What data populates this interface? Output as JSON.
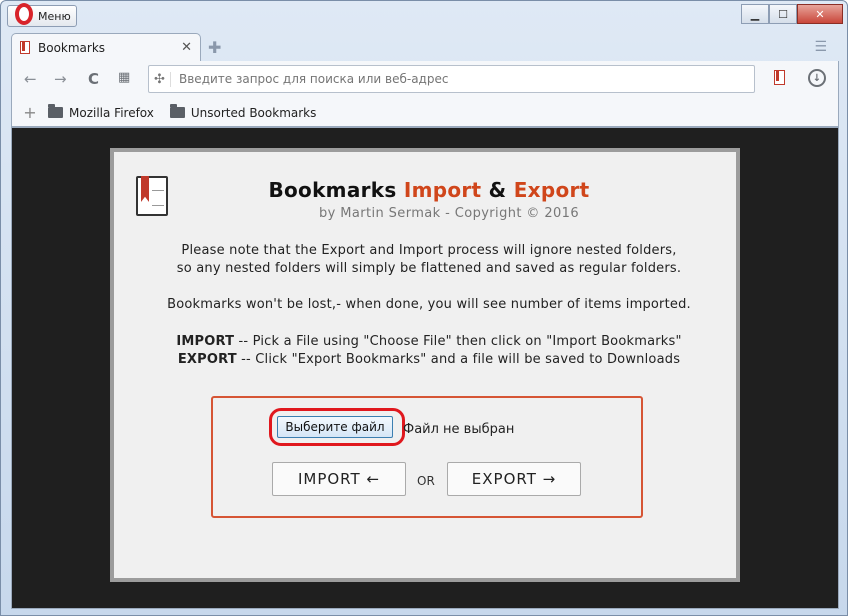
{
  "browser": {
    "menu_label": "Меню",
    "tab_title": "Bookmarks",
    "tab_close": "✕",
    "new_tab": "✚",
    "address_placeholder": "Введите запрос для поиска или веб-адрес",
    "bookmarks_bar": [
      {
        "label": "Mozilla Firefox"
      },
      {
        "label": "Unsorted Bookmarks"
      }
    ]
  },
  "page": {
    "title_part1": "Bookmarks ",
    "title_import": "Import",
    "title_amp": " & ",
    "title_export": "Export",
    "subtitle": "by Martin Sermak - Copyright © 2016",
    "note_line1": "Please note that the Export and Import process will ignore nested folders,",
    "note_line2": "so any nested folders will simply be flattened and saved as regular folders.",
    "note_line3": "Bookmarks won't be lost,- when done, you will see number of items imported.",
    "import_keyword": "IMPORT",
    "import_text": " -- Pick a File using \"Choose File\" then click on \"Import Bookmarks\"",
    "export_keyword": "EXPORT",
    "export_text": " -- Click \"Export Bookmarks\" and a file will be saved to Downloads",
    "choose_file_label": "Выберите файл",
    "no_file_text": "Файл не выбран",
    "import_button": "IMPORT  ←",
    "or_label": "OR",
    "export_button": "EXPORT  →"
  },
  "colors": {
    "accent": "#d0461b",
    "highlight": "#e0181e"
  }
}
